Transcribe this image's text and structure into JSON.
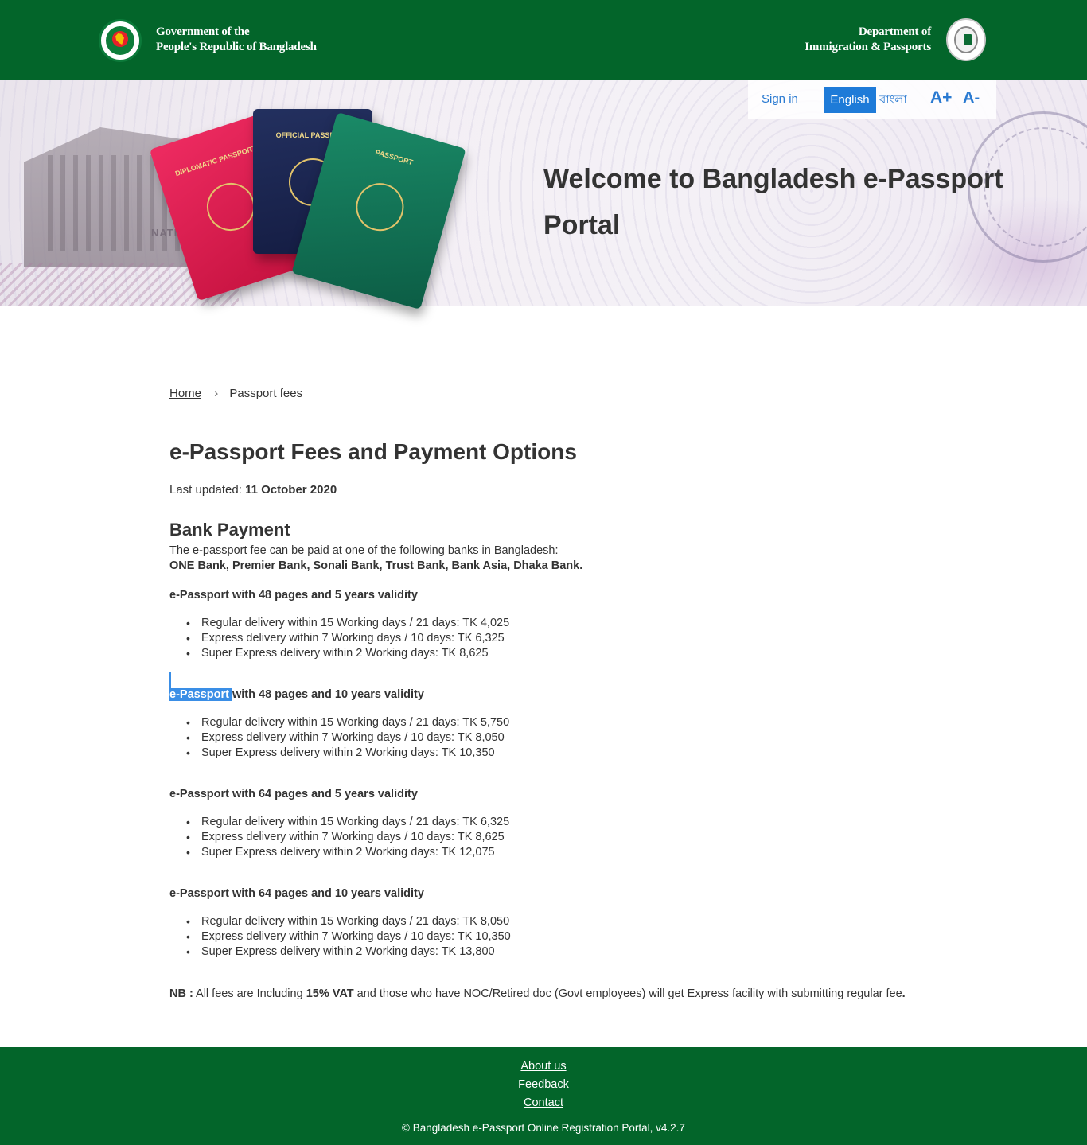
{
  "header": {
    "gov_line1": "Government of the",
    "gov_line2": "People's Republic of Bangladesh",
    "dept_line1": "Department of",
    "dept_line2": "Immigration & Passports",
    "brand_color": "#03652a"
  },
  "hero": {
    "welcome": "Welcome to Bangladesh e-Passport Portal",
    "passport_red": "DIPLOMATIC PASSPORT",
    "passport_blue": "OFFICIAL PASSPORT",
    "passport_green": "PASSPORT",
    "national_text": "NATIONAL"
  },
  "toolbar": {
    "signin": "Sign in",
    "lang_english": "English",
    "lang_bangla": "বাংলা",
    "font_increase": "A+",
    "font_decrease": "A-",
    "accent_color": "#1e7bd8"
  },
  "breadcrumb": {
    "home": "Home",
    "current": "Passport fees"
  },
  "page": {
    "title": "e-Passport Fees and Payment Options",
    "updated_label": "Last updated:",
    "updated_date": "11 October 2020",
    "section_title": "Bank Payment",
    "intro": "The e-passport fee can be paid at one of the following banks in Bangladesh:",
    "banks": "ONE Bank, Premier Bank, Sonali Bank, Trust Bank, Bank Asia, Dhaka Bank."
  },
  "fee_groups": [
    {
      "title": "e-Passport with 48 pages and 5 years validity",
      "items": [
        "Regular delivery within 15 Working days / 21 days: TK 4,025",
        "Express delivery within 7 Working days / 10 days: TK 6,325",
        "Super Express delivery within 2 Working days: TK 8,625"
      ]
    },
    {
      "title_highlight": "e-Passport ",
      "title_rest": "with 48 pages and 10 years validity",
      "items": [
        "Regular delivery within 15 Working days / 21 days: TK 5,750",
        "Express delivery within 7 Working days / 10 days: TK 8,050",
        "Super Express delivery within 2 Working days: TK 10,350"
      ]
    },
    {
      "title": "e-Passport with 64 pages and 5 years validity",
      "items": [
        "Regular delivery within 15 Working days / 21 days: TK 6,325",
        "Express delivery within 7 Working days / 10 days: TK 8,625",
        "Super Express delivery within 2 Working days: TK 12,075"
      ]
    },
    {
      "title": "e-Passport with 64 pages and 10 years validity",
      "items": [
        "Regular delivery within 15 Working days / 21 days: TK 8,050",
        "Express delivery within 7 Working days / 10 days: TK 10,350",
        "Super Express delivery within 2 Working days: TK 13,800"
      ]
    }
  ],
  "note": {
    "label": "NB :",
    "text1": " All fees are Including ",
    "vat": "15% VAT",
    "text2": " and those who have NOC/Retired doc (Govt employees) will get Express facility with submitting regular fee",
    "period": "."
  },
  "footer": {
    "about": "About us",
    "feedback": "Feedback",
    "contact": "Contact",
    "copyright": "© Bangladesh e-Passport Online Registration Portal, v4.2.7"
  }
}
